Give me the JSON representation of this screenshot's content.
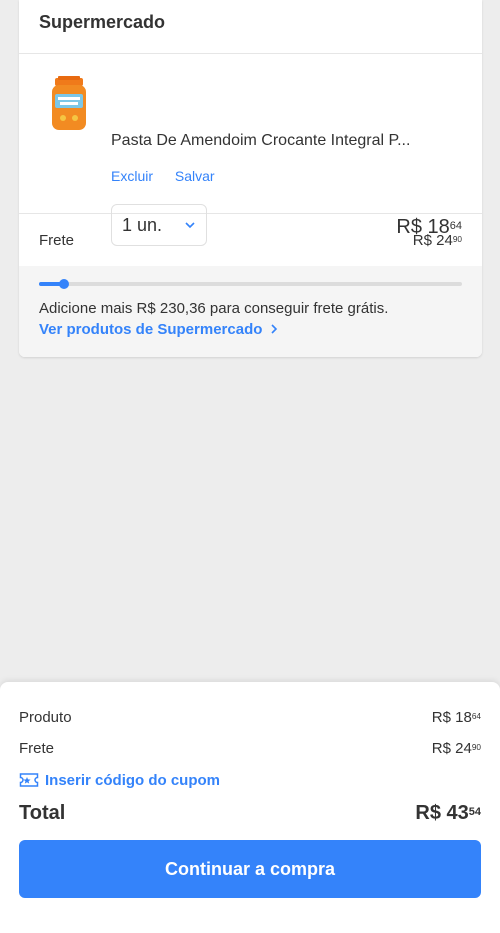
{
  "card": {
    "title": "Supermercado",
    "item": {
      "name": "Pasta De Amendoim Crocante Integral P...",
      "delete_label": "Excluir",
      "save_label": "Salvar",
      "quantity": "1 un.",
      "price_main": "R$ 18",
      "price_cents": "64"
    },
    "shipping": {
      "label": "Frete",
      "price_main": "R$ 24",
      "price_cents": "90",
      "progress_fraction": 0.06,
      "message": "Adicione mais R$ 230,36 para conseguir frete grátis.",
      "link": "Ver produtos de Supermercado"
    }
  },
  "summary": {
    "product_label": "Produto",
    "product_main": "R$ 18",
    "product_cents": "64",
    "shipping_label": "Frete",
    "shipping_main": "R$ 24",
    "shipping_cents": "90",
    "coupon_label": "Inserir código do cupom",
    "total_label": "Total",
    "total_main": "R$ 43",
    "total_cents": "54",
    "continue_button": "Continuar a compra"
  },
  "colors": {
    "accent": "#3483fa",
    "background": "#ededed"
  }
}
